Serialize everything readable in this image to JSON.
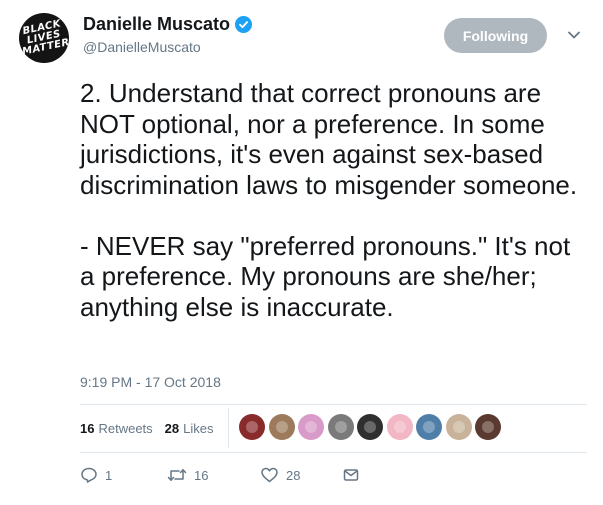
{
  "author": {
    "avatar_lines": [
      "BLACK",
      "LIVES",
      "MATTER"
    ],
    "display_name": "Danielle Muscato",
    "handle": "@DanielleMuscato",
    "verified": true
  },
  "follow_button": {
    "label": "Following"
  },
  "tweet": {
    "paragraphs": [
      "2. Understand that correct pronouns are NOT optional, nor a preference. In some jurisdictions, it's even against sex-based discrimination laws to misgender someone.",
      "- NEVER say \"preferred pronouns.\" It's not a preference. My pronouns are she/her; anything else is inaccurate."
    ],
    "timestamp": "9:19 PM - 17 Oct 2018"
  },
  "stats": {
    "retweets_count": "16",
    "retweets_label": "Retweets",
    "likes_count": "28",
    "likes_label": "Likes"
  },
  "likers": [
    {
      "icon": "liker-avatar-icon",
      "color": "#8a2b2b"
    },
    {
      "icon": "liker-avatar-icon",
      "color": "#9c7a5b"
    },
    {
      "icon": "liker-avatar-icon",
      "color": "#d89ac8"
    },
    {
      "icon": "liker-avatar-icon",
      "color": "#7a7a7a"
    },
    {
      "icon": "liker-avatar-icon",
      "color": "#2f2f2f"
    },
    {
      "icon": "liker-avatar-icon",
      "color": "#f3b6c4"
    },
    {
      "icon": "liker-avatar-icon",
      "color": "#4f7fa8"
    },
    {
      "icon": "liker-avatar-icon",
      "color": "#c8b39a"
    },
    {
      "icon": "liker-avatar-icon",
      "color": "#5a3a30"
    }
  ],
  "actions": {
    "reply_count": "1",
    "retweet_count": "16",
    "like_count": "28"
  },
  "colors": {
    "accent": "#1da1f2",
    "secondary_text": "#657786",
    "follow_button_bg": "#b0b8bf"
  }
}
